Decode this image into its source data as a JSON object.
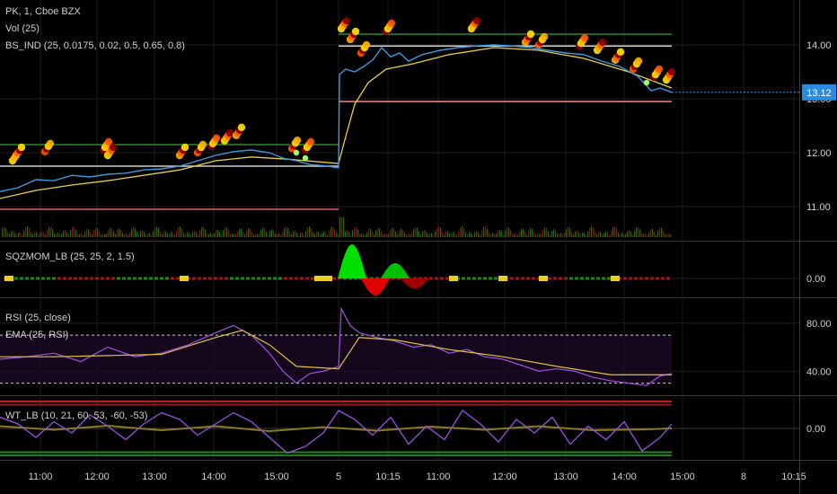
{
  "chart_data": {
    "type": "line",
    "title": "PK, 1, Cboe BZX",
    "panes": {
      "price": {
        "labels": [
          "PK, 1, Cboe BZX",
          "Vol (25)",
          "BS_IND (25, 0.0175, 0.02, 0.5, 0.65, 0.8)"
        ],
        "y_ticks": [
          "14.00",
          "13.00",
          "12.00",
          "11.00"
        ],
        "ylim": [
          10.7,
          14.5
        ],
        "last_price": "13.12",
        "ref_lines": {
          "red": [
            10.95,
            12.95
          ],
          "white": [
            11.75,
            13.98
          ],
          "green": [
            12.15,
            14.2
          ]
        },
        "price_series": [
          [
            0,
            11.28
          ],
          [
            20,
            11.35
          ],
          [
            40,
            11.5
          ],
          [
            60,
            11.48
          ],
          [
            80,
            11.58
          ],
          [
            100,
            11.55
          ],
          [
            120,
            11.6
          ],
          [
            140,
            11.62
          ],
          [
            160,
            11.68
          ],
          [
            180,
            11.7
          ],
          [
            200,
            11.75
          ],
          [
            220,
            11.85
          ],
          [
            240,
            11.95
          ],
          [
            260,
            12.02
          ],
          [
            280,
            12.05
          ],
          [
            300,
            12.0
          ],
          [
            315,
            11.9
          ],
          [
            330,
            11.85
          ],
          [
            345,
            11.78
          ],
          [
            360,
            11.76
          ],
          [
            377,
            11.72
          ],
          [
            378,
            13.45
          ],
          [
            385,
            13.55
          ],
          [
            395,
            13.5
          ],
          [
            405,
            13.6
          ],
          [
            415,
            13.72
          ],
          [
            425,
            13.95
          ],
          [
            435,
            13.78
          ],
          [
            445,
            13.85
          ],
          [
            455,
            13.7
          ],
          [
            470,
            13.82
          ],
          [
            490,
            13.9
          ],
          [
            510,
            13.95
          ],
          [
            530,
            13.98
          ],
          [
            550,
            14.0
          ],
          [
            570,
            13.98
          ],
          [
            590,
            13.95
          ],
          [
            610,
            13.9
          ],
          [
            630,
            13.85
          ],
          [
            650,
            13.82
          ],
          [
            670,
            13.7
          ],
          [
            690,
            13.6
          ],
          [
            710,
            13.42
          ],
          [
            725,
            13.15
          ],
          [
            735,
            13.2
          ],
          [
            748,
            13.12
          ]
        ],
        "ema_series": [
          [
            0,
            11.15
          ],
          [
            40,
            11.3
          ],
          [
            80,
            11.4
          ],
          [
            120,
            11.48
          ],
          [
            160,
            11.58
          ],
          [
            200,
            11.68
          ],
          [
            240,
            11.85
          ],
          [
            280,
            11.92
          ],
          [
            320,
            11.88
          ],
          [
            377,
            11.8
          ],
          [
            385,
            12.3
          ],
          [
            395,
            12.9
          ],
          [
            410,
            13.3
          ],
          [
            430,
            13.55
          ],
          [
            460,
            13.65
          ],
          [
            500,
            13.82
          ],
          [
            550,
            13.95
          ],
          [
            600,
            13.9
          ],
          [
            650,
            13.75
          ],
          [
            700,
            13.5
          ],
          [
            748,
            13.2
          ]
        ],
        "x_ticks": [
          "11:00",
          "12:00",
          "13:00",
          "14:00",
          "15:00",
          "5",
          "10:15",
          "11:00",
          "12:00",
          "13:00",
          "14:00",
          "15:00",
          "8",
          "10:15"
        ]
      },
      "sqzmom": {
        "label": "SQZMOM_LB (25, 25, 2, 1.5)",
        "y_ticks": [
          "0.00"
        ],
        "histogram_highlights": [
          {
            "x": 392,
            "value": 1.0,
            "color": "#00e000"
          },
          {
            "x": 418,
            "value": -0.5,
            "color": "#e00000"
          },
          {
            "x": 440,
            "value": 0.45,
            "color": "#00c000"
          },
          {
            "x": 462,
            "value": -0.3,
            "color": "#a00000"
          }
        ]
      },
      "rsi": {
        "label": "RSI (25, close)",
        "sub_label": "EMA (25, RSI)",
        "y_ticks": [
          "80.00",
          "40.00"
        ],
        "ylim": [
          20,
          100
        ],
        "bands": [
          70,
          30
        ],
        "rsi_series": [
          [
            0,
            50
          ],
          [
            30,
            52
          ],
          [
            60,
            55
          ],
          [
            90,
            48
          ],
          [
            120,
            60
          ],
          [
            150,
            52
          ],
          [
            180,
            55
          ],
          [
            210,
            62
          ],
          [
            240,
            72
          ],
          [
            260,
            78
          ],
          [
            280,
            70
          ],
          [
            300,
            55
          ],
          [
            315,
            40
          ],
          [
            330,
            30
          ],
          [
            345,
            38
          ],
          [
            360,
            40
          ],
          [
            377,
            44
          ],
          [
            380,
            92
          ],
          [
            390,
            78
          ],
          [
            400,
            72
          ],
          [
            420,
            68
          ],
          [
            440,
            65
          ],
          [
            460,
            60
          ],
          [
            480,
            62
          ],
          [
            500,
            55
          ],
          [
            520,
            58
          ],
          [
            540,
            52
          ],
          [
            560,
            50
          ],
          [
            580,
            45
          ],
          [
            600,
            40
          ],
          [
            620,
            42
          ],
          [
            640,
            40
          ],
          [
            660,
            35
          ],
          [
            680,
            32
          ],
          [
            700,
            30
          ],
          [
            720,
            28
          ],
          [
            735,
            36
          ],
          [
            748,
            38
          ]
        ],
        "ema_series": [
          [
            0,
            52
          ],
          [
            60,
            52
          ],
          [
            120,
            53
          ],
          [
            180,
            54
          ],
          [
            240,
            68
          ],
          [
            270,
            74
          ],
          [
            300,
            62
          ],
          [
            330,
            44
          ],
          [
            377,
            42
          ],
          [
            400,
            68
          ],
          [
            440,
            66
          ],
          [
            500,
            58
          ],
          [
            560,
            52
          ],
          [
            620,
            44
          ],
          [
            680,
            37
          ],
          [
            748,
            37
          ]
        ]
      },
      "wt": {
        "label": "WT_LB (10, 21, 60, 53, -60, -53)",
        "y_ticks": [
          "0.00"
        ],
        "ylim": [
          -70,
          70
        ],
        "bands": [
          60,
          53,
          -53,
          -60
        ],
        "wt1_series": [
          [
            0,
            25
          ],
          [
            20,
            10
          ],
          [
            40,
            -20
          ],
          [
            60,
            15
          ],
          [
            80,
            -10
          ],
          [
            100,
            30
          ],
          [
            120,
            5
          ],
          [
            140,
            -25
          ],
          [
            160,
            10
          ],
          [
            180,
            35
          ],
          [
            200,
            20
          ],
          [
            220,
            -15
          ],
          [
            240,
            10
          ],
          [
            260,
            35
          ],
          [
            280,
            15
          ],
          [
            300,
            -20
          ],
          [
            320,
            -55
          ],
          [
            340,
            -40
          ],
          [
            360,
            -10
          ],
          [
            377,
            40
          ],
          [
            395,
            20
          ],
          [
            415,
            -15
          ],
          [
            435,
            25
          ],
          [
            455,
            -35
          ],
          [
            475,
            5
          ],
          [
            495,
            -25
          ],
          [
            515,
            40
          ],
          [
            535,
            10
          ],
          [
            555,
            -30
          ],
          [
            575,
            20
          ],
          [
            595,
            -10
          ],
          [
            615,
            25
          ],
          [
            635,
            -35
          ],
          [
            655,
            5
          ],
          [
            675,
            -25
          ],
          [
            695,
            15
          ],
          [
            715,
            -50
          ],
          [
            735,
            -20
          ],
          [
            748,
            10
          ]
        ],
        "wt2_series": [
          [
            0,
            5
          ],
          [
            60,
            -3
          ],
          [
            120,
            6
          ],
          [
            180,
            -4
          ],
          [
            240,
            5
          ],
          [
            300,
            -6
          ],
          [
            360,
            3
          ],
          [
            420,
            -5
          ],
          [
            480,
            4
          ],
          [
            540,
            -3
          ],
          [
            600,
            5
          ],
          [
            660,
            -4
          ],
          [
            720,
            -2
          ],
          [
            748,
            0
          ]
        ]
      }
    }
  }
}
